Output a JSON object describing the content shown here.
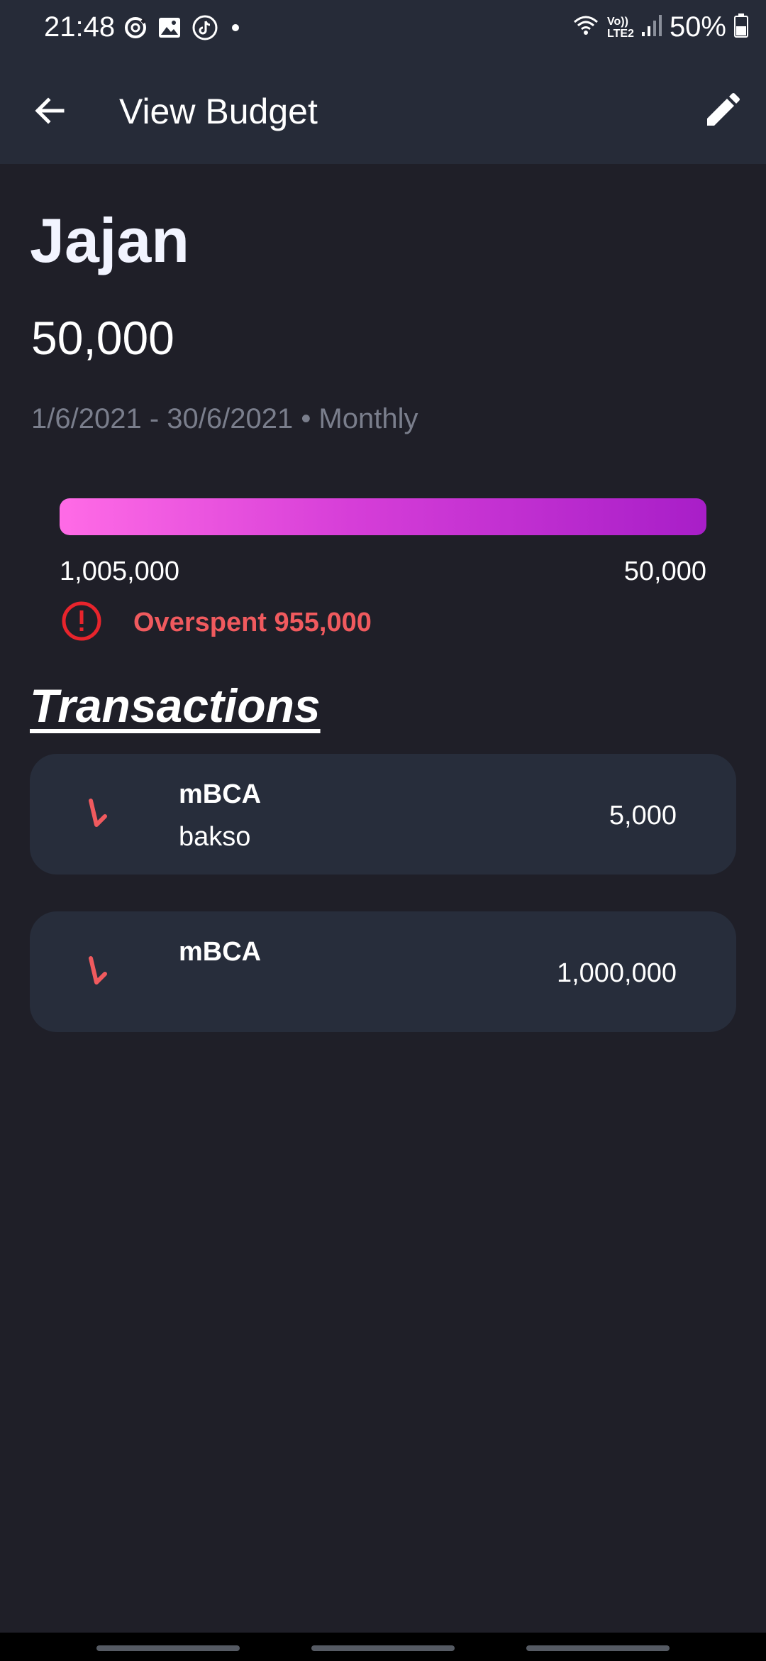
{
  "status_bar": {
    "time": "21:48",
    "left_icons": [
      "sync-icon",
      "gallery-icon",
      "tiktok-icon",
      "dot-icon"
    ],
    "right_icons": [
      "wifi-icon",
      "volte-icon",
      "signal-icon",
      "battery-icon"
    ],
    "network_top": "Vo))",
    "network_bottom": "LTE2",
    "battery": "50%"
  },
  "app_bar": {
    "title": "View Budget",
    "back_icon": "arrow-back-icon",
    "edit_icon": "pencil-icon"
  },
  "budget": {
    "name": "Jajan",
    "amount": "50,000",
    "period": "1/6/2021 - 30/6/2021 • Monthly",
    "progress_fraction": 1.0,
    "spent_label": "1,005,000",
    "limit_label": "50,000",
    "overspent_text": "Overspent 955,000",
    "colors": {
      "progress_start": "#ff6be6",
      "progress_end": "#a81ec8",
      "overspent": "#f05a5e"
    }
  },
  "transactions": {
    "title": "Transactions",
    "items": [
      {
        "account": "mBCA",
        "note": "bakso",
        "amount": "5,000",
        "icon": "expense-arrow-icon"
      },
      {
        "account": "mBCA",
        "note": "",
        "amount": "1,000,000",
        "icon": "expense-arrow-icon"
      }
    ]
  }
}
